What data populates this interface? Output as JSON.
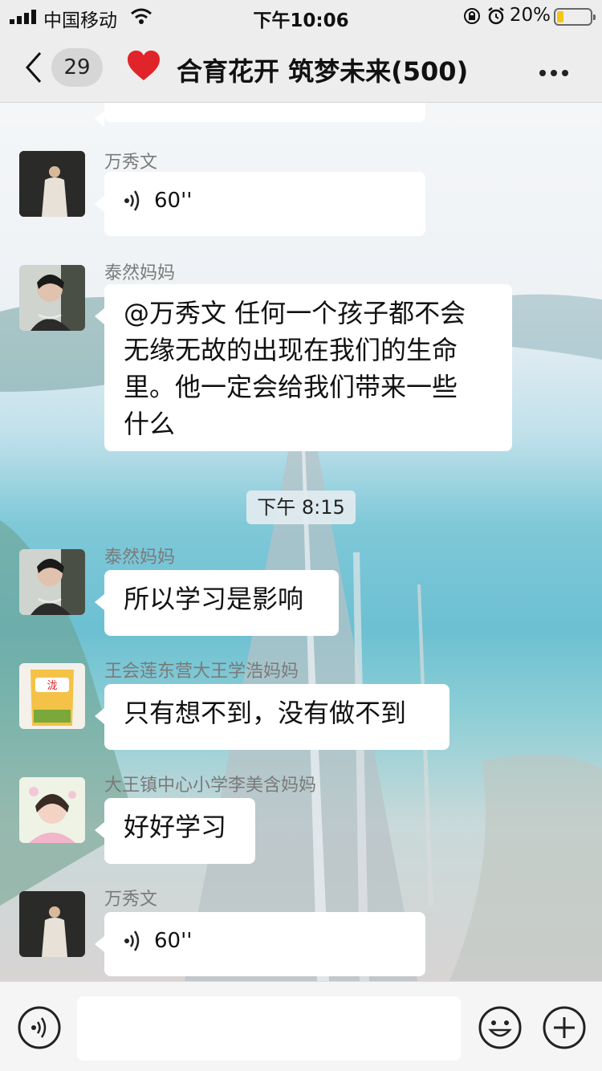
{
  "status_bar": {
    "carrier": "中国移动",
    "time": "下午10:06",
    "battery": "20%"
  },
  "nav": {
    "unread_count": "29",
    "title": "合育花开 筑梦未来(500)"
  },
  "messages": [
    {
      "sender": "万秀文",
      "type": "voice",
      "duration": "60''"
    },
    {
      "sender": "泰然妈妈",
      "type": "text",
      "lines": [
        "@万秀文 任何一个孩子都不会",
        "无缘无故的出现在我们的生命",
        "里。他一定会给我们带来一些",
        "什么"
      ]
    },
    {
      "sender": "泰然妈妈",
      "type": "text",
      "lines": [
        "所以学习是影响"
      ]
    },
    {
      "sender": "王会莲东营大王学浩妈妈",
      "type": "text",
      "lines": [
        "只有想不到，没有做不到"
      ]
    },
    {
      "sender": "大王镇中心小学李美含妈妈",
      "type": "text",
      "lines": [
        "好好学习"
      ]
    },
    {
      "sender": "万秀文",
      "type": "voice",
      "duration": "60''"
    }
  ],
  "timestamp": "下午 8:15",
  "icons": {
    "back": "chevron-left-icon",
    "heart": "heart-icon",
    "more": "more-icon",
    "voice_wave": "voice-wave-icon",
    "voice_input": "voice-input-icon",
    "emoji": "emoji-icon",
    "plus": "plus-icon"
  },
  "colors": {
    "bar_bg": "#ededed",
    "bubble_bg": "#ffffff",
    "heart": "#e0242a",
    "battery_fill": "#f5c518"
  }
}
